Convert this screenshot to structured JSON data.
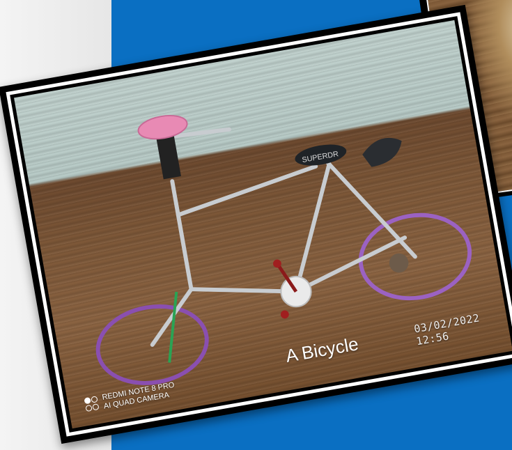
{
  "photo": {
    "caption": "A Bicycle",
    "timestamp": "03/02/2022 12:56",
    "watermark_line1": "REDMI NOTE 8 PRO",
    "watermark_line2": "AI QUAD CAMERA",
    "brand_text": "SUPERDR"
  },
  "colors": {
    "background_blue": "#0a6fc2",
    "frame": "#000000",
    "wheel": "#8a4fb0",
    "seat": "#e88ab4"
  }
}
